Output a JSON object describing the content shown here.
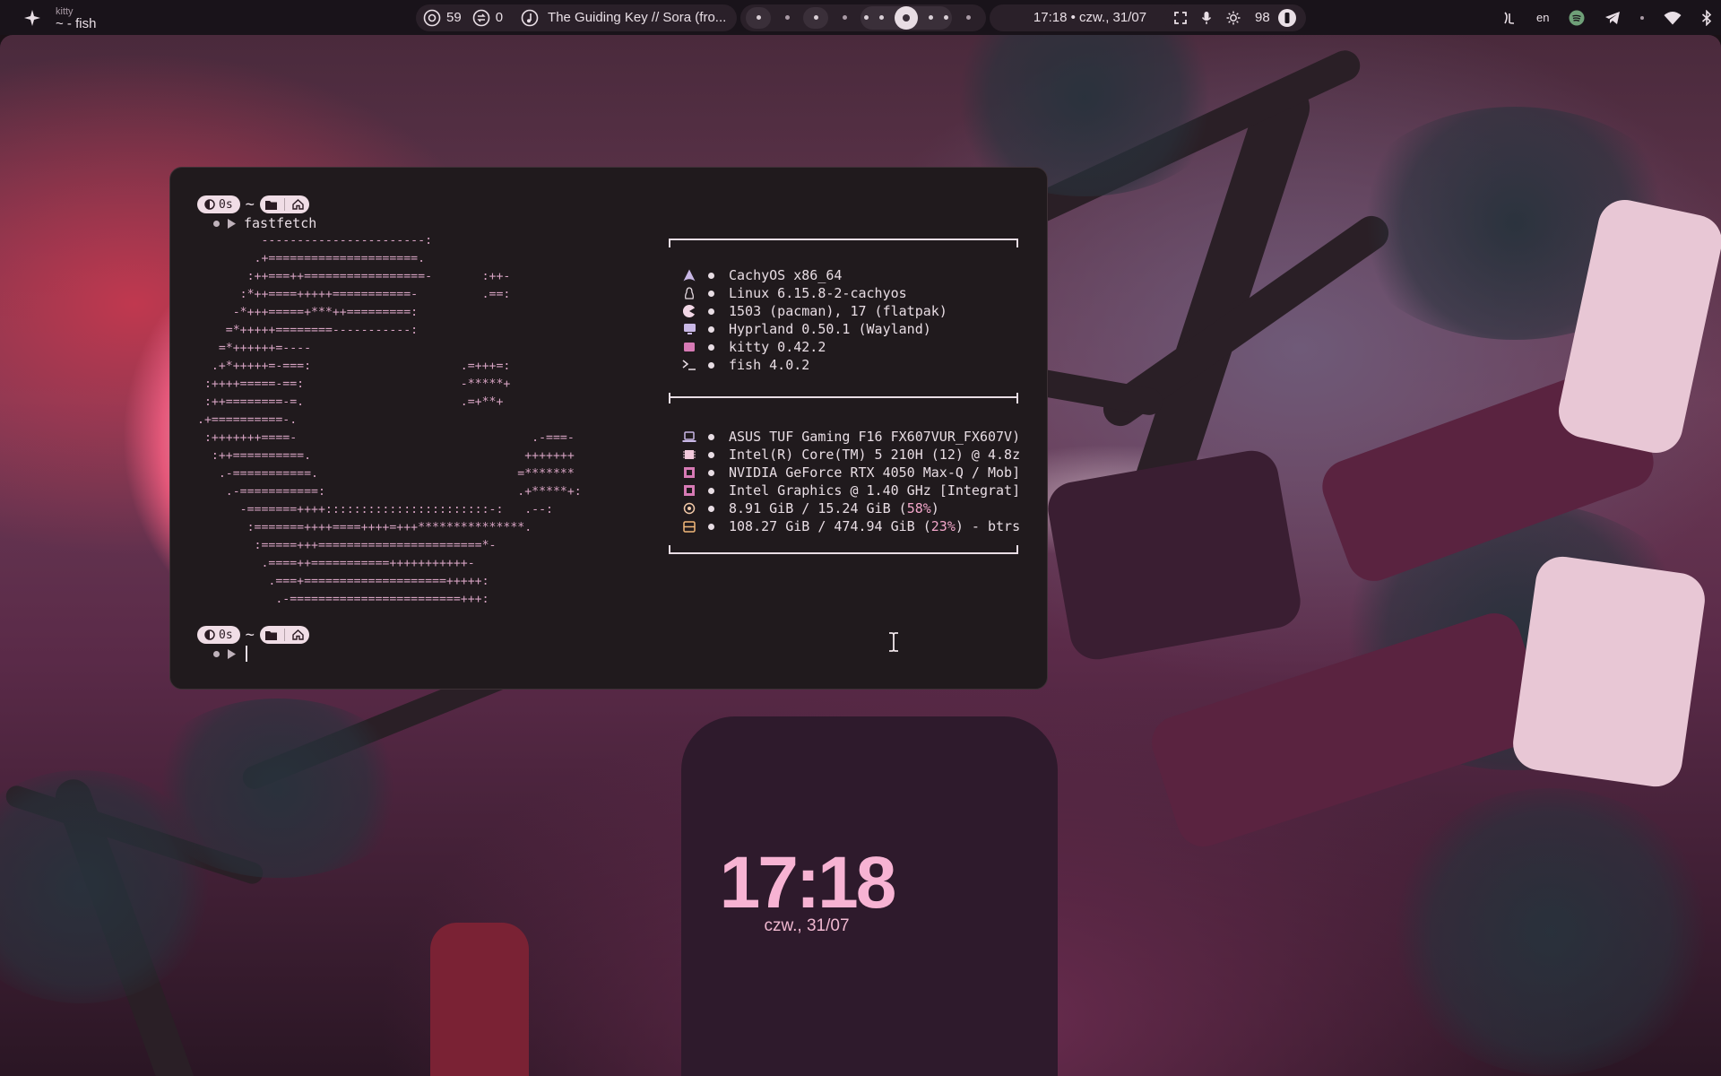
{
  "topbar": {
    "app_class": "kitty",
    "app_title": "~ - fish",
    "stat_a": "59",
    "stat_b": "0",
    "media_title": "The Guiding Key // Sora (fro...",
    "clock": "17:18 • czw., 31/07",
    "brightness": "98",
    "lang": "en"
  },
  "terminal": {
    "prompt1": {
      "duration": "0s",
      "dir": "~",
      "command": "fastfetch"
    },
    "prompt2": {
      "duration": "0s",
      "dir": "~",
      "command": ""
    },
    "ascii_lines": [
      "         -----------------------:",
      "        .+=====================.",
      "       :++===++=================-       :++-",
      "      :*++====+++++===========-         .==:",
      "     -*+++=====+***++=========:",
      "    =*+++++========-----------:",
      "   =*++++++=----",
      "  .+*+++++=-===:                     .=+++=:",
      " :++++=====-==:                      -*****+",
      " :++========-=.                      .=+**+",
      ".+==========-.",
      " :+++++++====-                                 .-===-",
      "  :++==========.                              +++++++",
      "   .-===========.                            =*******",
      "    .-===========:                           .+*****+:",
      "      -=======++++:::::::::::::::::::::::-:   .--:",
      "       :=======++++====++++=+++***************.",
      "        :=====+++=======================*-",
      "         .====++===========+++++++++++-",
      "          .===+====================+++++:",
      "           .-========================+++:"
    ],
    "software": [
      {
        "icon": "arch-icon",
        "text": "CachyOS x86_64"
      },
      {
        "icon": "linux-icon",
        "text": "Linux 6.15.8-2-cachyos"
      },
      {
        "icon": "package-icon",
        "text": "1503 (pacman), 17 (flatpak)"
      },
      {
        "icon": "monitor-icon",
        "text": "Hyprland 0.50.1 (Wayland)"
      },
      {
        "icon": "terminal-icon",
        "text": "kitty 0.42.2"
      },
      {
        "icon": "shell-icon",
        "text": "fish 4.0.2"
      }
    ],
    "hardware": [
      {
        "icon": "laptop-icon",
        "text": "ASUS TUF Gaming F16 FX607VUR_FX607V)"
      },
      {
        "icon": "cpu-icon",
        "text": "Intel(R) Core(TM) 5 210H (12) @ 4.8z"
      },
      {
        "icon": "gpu-icon",
        "text": "NVIDIA GeForce RTX 4050 Max-Q / Mob]"
      },
      {
        "icon": "gpu-icon",
        "text": "Intel Graphics @ 1.40 GHz [Integrat]"
      },
      {
        "icon": "memory-icon",
        "text_pre": "8.91 GiB / 15.24 GiB (",
        "text_hi": "58%",
        "text_post": ")"
      },
      {
        "icon": "disk-icon",
        "text_pre": "108.27 GiB / 474.94 GiB (",
        "text_hi": "23%",
        "text_post": ") - btrs"
      }
    ]
  },
  "desktop_clock": {
    "time": "17:18",
    "date": "czw., 31/07"
  },
  "colors": {
    "accent": "#f2a6c9",
    "bar_bg": "#19131a",
    "terminal_bg": "#201a1d"
  }
}
